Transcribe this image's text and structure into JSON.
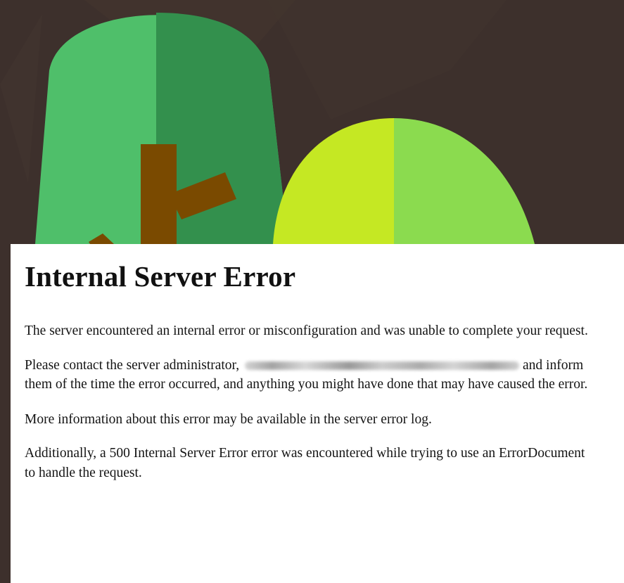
{
  "page": {
    "title": "Internal Server Error",
    "paragraphs": {
      "p1": "The server encountered an internal error or misconfiguration and was unable to complete your request.",
      "p2_before": "Please contact the server administrator,",
      "p2_after": "and inform them of the time the error occurred, and anything you might have done that may have caused the error.",
      "p3": "More information about this error may be available in the server error log.",
      "p4": "Additionally, a 500 Internal Server Error error was encountered while trying to use an ErrorDocument to handle the request."
    }
  },
  "colors": {
    "background": "#3d302c",
    "tree_left_light": "#4fbf6a",
    "tree_left_dark": "#33904d",
    "trunk": "#7a4a00",
    "tree_right_yellow": "#c5e823",
    "tree_right_green": "#8bdb4f",
    "panel": "#ffffff"
  },
  "icons": {
    "background": "tree-illustration",
    "redaction": "blurred-email"
  }
}
